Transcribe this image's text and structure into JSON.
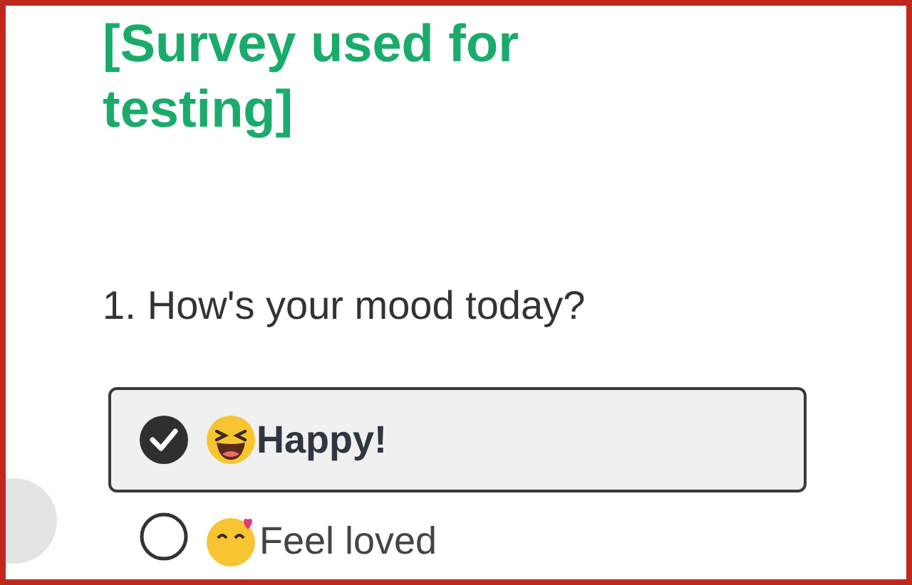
{
  "survey": {
    "title": "[Survey used for testing]"
  },
  "question": {
    "number": "1.",
    "text": "How's your mood today?",
    "options": [
      {
        "label": "Happy!",
        "selected": true,
        "kind": "laughing"
      },
      {
        "label": "Feel loved",
        "selected": false,
        "kind": "hearts"
      }
    ]
  }
}
